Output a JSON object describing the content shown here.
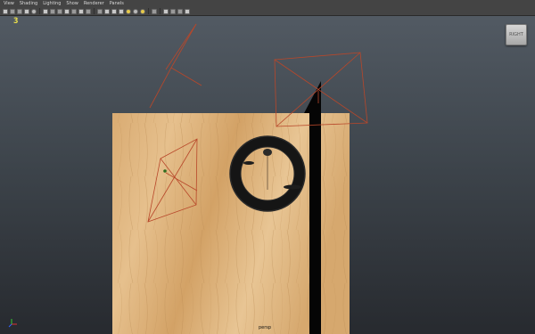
{
  "menu": [
    "View",
    "Shading",
    "Lighting",
    "Show",
    "Renderer",
    "Panels"
  ],
  "viewport": {
    "hud_number": "3",
    "viewcube_label": "RIGHT",
    "camera_label": "persp"
  },
  "colors": {
    "wood_light": "#e2b984",
    "wood_dark": "#c99a5e",
    "wireframe": "#b8472a",
    "ring": "#161616",
    "background_top": "#525a63",
    "background_bottom": "#272a2f",
    "hud_yellow": "#f2e64a"
  },
  "icons": {
    "axis": "axis-gizmo-icon",
    "viewcube": "viewcube-icon"
  }
}
